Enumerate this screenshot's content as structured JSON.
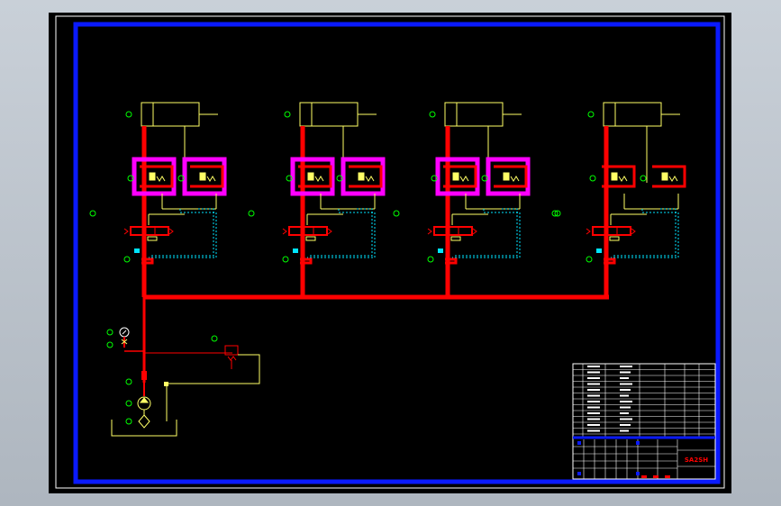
{
  "drawing": {
    "title_block_name": "SA2SH",
    "colors": {
      "window_background": "#b8c0c8",
      "sheet": "#000000",
      "border": "#0a1aff",
      "main_line": "#ff0000",
      "component": "#ffff66",
      "highlight": "#ff00ff",
      "pilot_line": "#00e5ff",
      "balloon": "#00ff00",
      "table": "#ffffff"
    },
    "circuits": [
      {
        "id": "A",
        "highlighted": true
      },
      {
        "id": "B",
        "highlighted": true
      },
      {
        "id": "C",
        "highlighted": true
      },
      {
        "id": "D",
        "highlighted": false
      }
    ],
    "parts_table": {
      "rows": 12,
      "columns": 6
    },
    "icons": [
      "pressure-gauge-icon",
      "pump-icon",
      "filter-icon",
      "relief-valve-icon",
      "cylinder-icon",
      "directional-valve-icon"
    ]
  }
}
